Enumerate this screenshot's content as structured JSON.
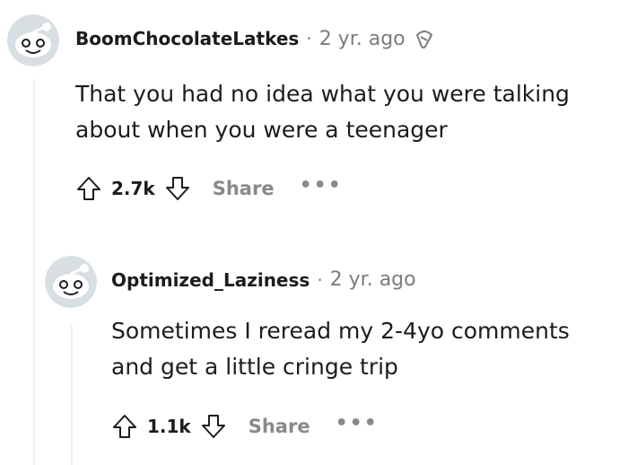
{
  "comments": [
    {
      "username": "BoomChocolateLatkes",
      "separator": "·",
      "time": "2 yr. ago",
      "award_icon": "award-icon",
      "lines": [
        "That you had no idea what you were talking",
        "about when you were a teenager"
      ],
      "score": "2.7k",
      "share_label": "Share",
      "more_label": "•••"
    },
    {
      "username": "Optimized_Laziness",
      "separator": "·",
      "time": "2 yr. ago",
      "lines": [
        "Sometimes I reread my 2-4yo comments",
        "and get a little cringe trip"
      ],
      "score": "1.1k",
      "share_label": "Share",
      "more_label": "•••"
    }
  ],
  "colors": {
    "avatar_bg": "#d7dfe2",
    "snoo_white": "#ffffff",
    "thread_line": "#edeff1",
    "muted_text": "#7c7c7c",
    "action_grey": "#878a8c"
  }
}
